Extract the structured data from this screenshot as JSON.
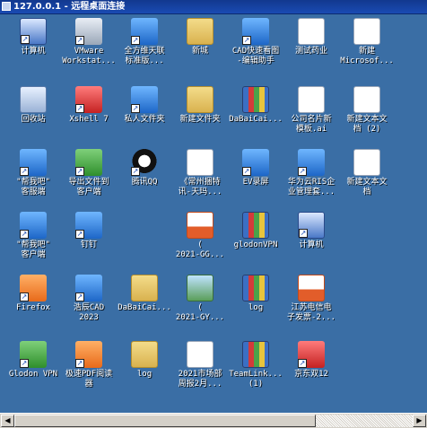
{
  "window": {
    "title": "127.0.0.1 - 远程桌面连接"
  },
  "desktop": {
    "icons": [
      {
        "label": "计算机",
        "icon": "computer-icon",
        "kind": "pc"
      },
      {
        "label": "VMware\nWorkstat...",
        "icon": "vmware-icon",
        "kind": "app-gray"
      },
      {
        "label": "全方维天联\n标准版...",
        "icon": "app-icon",
        "kind": "app-blue"
      },
      {
        "label": "新城",
        "icon": "folder-icon",
        "kind": "folder"
      },
      {
        "label": "CAD快速看图\n-编辑助手",
        "icon": "cad-viewer-icon",
        "kind": "app-blue"
      },
      {
        "label": "测试药业",
        "icon": "document-icon",
        "kind": "doc"
      },
      {
        "label": "新建\nMicrosof...",
        "icon": "document-icon",
        "kind": "doc"
      },
      {
        "label": "回收站",
        "icon": "recycle-bin-icon",
        "kind": "recycle"
      },
      {
        "label": "Xshell 7",
        "icon": "xshell-icon",
        "kind": "app-red"
      },
      {
        "label": "私人文件夹",
        "icon": "cloud-folder-icon",
        "kind": "app-blue"
      },
      {
        "label": "新建文件夹",
        "icon": "folder-icon",
        "kind": "folder"
      },
      {
        "label": "DaBaiCai...",
        "icon": "archive-icon",
        "kind": "zip"
      },
      {
        "label": "公司名片新\n模板.ai",
        "icon": "document-icon",
        "kind": "doc"
      },
      {
        "label": "新建文本文\n档 (2)",
        "icon": "text-file-icon",
        "kind": "doc"
      },
      {
        "label": "\"帮我吧\"\n客服端",
        "icon": "helper-icon",
        "kind": "app-blue"
      },
      {
        "label": "导出文件到\n客户端",
        "icon": "export-icon",
        "kind": "app-green"
      },
      {
        "label": "腾讯QQ",
        "icon": "qq-icon",
        "kind": "app-qq"
      },
      {
        "label": "《常州捆特\n讯-天玛...",
        "icon": "spreadsheet-icon",
        "kind": "doc"
      },
      {
        "label": "EV录屏",
        "icon": "screen-recorder-icon",
        "kind": "app-blue"
      },
      {
        "label": "华为云RIS企\n业管理套...",
        "icon": "cloud-app-icon",
        "kind": "app-blue"
      },
      {
        "label": "新建文本文\n档",
        "icon": "text-file-icon",
        "kind": "doc"
      },
      {
        "label": "\"帮我吧\"\n客户端",
        "icon": "helper-icon",
        "kind": "app-blue"
      },
      {
        "label": "钉钉",
        "icon": "dingtalk-icon",
        "kind": "app-blue"
      },
      {
        "label": "",
        "icon": "",
        "kind": ""
      },
      {
        "label": "(\n2021-GG...",
        "icon": "pdf-icon",
        "kind": "pdf"
      },
      {
        "label": "glodonVPN",
        "icon": "archive-icon",
        "kind": "zip"
      },
      {
        "label": "计算机",
        "icon": "computer-icon",
        "kind": "pc"
      },
      {
        "label": "",
        "icon": "",
        "kind": ""
      },
      {
        "label": "Firefox",
        "icon": "firefox-icon",
        "kind": "app-orange"
      },
      {
        "label": "浩辰CAD\n2023",
        "icon": "cad-icon",
        "kind": "app-blue"
      },
      {
        "label": "DaBaiCai...",
        "icon": "folder-icon",
        "kind": "folder"
      },
      {
        "label": "(\n2021-GY...",
        "icon": "image-icon",
        "kind": "img"
      },
      {
        "label": "log",
        "icon": "archive-icon",
        "kind": "zip"
      },
      {
        "label": "江苏电信电\n子发票-2...",
        "icon": "pdf-icon",
        "kind": "pdf"
      },
      {
        "label": "",
        "icon": "",
        "kind": ""
      },
      {
        "label": "Glodon VPN",
        "icon": "glodon-vpn-icon",
        "kind": "app-green"
      },
      {
        "label": "极速PDF阅读\n器",
        "icon": "pdf-reader-icon",
        "kind": "app-orange"
      },
      {
        "label": "log",
        "icon": "folder-icon",
        "kind": "folder"
      },
      {
        "label": "2021市场部\n周报2月...",
        "icon": "spreadsheet-icon",
        "kind": "doc"
      },
      {
        "label": "TeamLink...\n(1)",
        "icon": "archive-icon",
        "kind": "zip"
      },
      {
        "label": "京东双12",
        "icon": "jd-icon",
        "kind": "app-red"
      },
      {
        "label": "",
        "icon": "",
        "kind": ""
      }
    ]
  },
  "scrollbar": {
    "left_arrow": "◀",
    "right_arrow": "▶"
  }
}
